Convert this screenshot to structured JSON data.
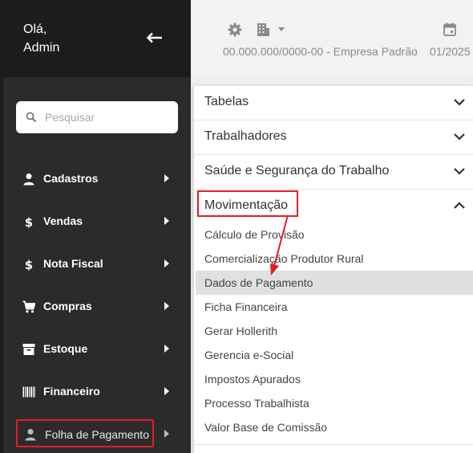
{
  "sidebar": {
    "greeting_line1": "Olá,",
    "greeting_line2": "Admin",
    "search_placeholder": "Pesquisar",
    "items": [
      {
        "label": "Cadastros",
        "icon": "person-icon"
      },
      {
        "label": "Vendas",
        "icon": "dollar-icon"
      },
      {
        "label": "Nota Fiscal",
        "icon": "dollar-icon"
      },
      {
        "label": "Compras",
        "icon": "cart-icon"
      },
      {
        "label": "Estoque",
        "icon": "archive-icon"
      },
      {
        "label": "Financeiro",
        "icon": "barcode-icon"
      },
      {
        "label": "Folha de Pagamento",
        "icon": "person-icon",
        "highlighted": true
      }
    ]
  },
  "topbar": {
    "company": "00.000.000/0000-00 - Empresa Padrão",
    "period": "01/2025"
  },
  "menu": {
    "sections": [
      {
        "label": "Tabelas",
        "expanded": false
      },
      {
        "label": "Trabalhadores",
        "expanded": false
      },
      {
        "label": "Saúde e Segurança do Trabalho",
        "expanded": false
      },
      {
        "label": "Movimentação",
        "expanded": true,
        "highlighted": true
      }
    ],
    "movimentacao_items": [
      "Cálculo de Provisão",
      "Comercialização Produtor Rural",
      "Dados de Pagamento",
      "Ficha Financeira",
      "Gerar Hollerith",
      "Gerencia e-Social",
      "Impostos Apurados",
      "Processo Trabalhista",
      "Valor Base de Comissão"
    ],
    "active_item": "Dados de Pagamento"
  },
  "colors": {
    "sidebar_bg": "#2b2b2b",
    "sidebar_header_bg": "#1c1c1c",
    "highlight_red": "#e01e25",
    "active_item_bg": "#e0e0e0"
  }
}
